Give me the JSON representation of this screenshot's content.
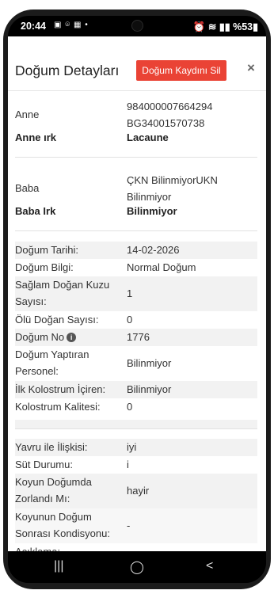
{
  "status_bar": {
    "time": "20:44",
    "left_icons": "▣ ⌾ ▦ •",
    "right_icons": "⏰ ≋ ▮▮ %53▮"
  },
  "modal": {
    "title": "Doğum Detayları",
    "delete_button": "Doğum Kaydını Sil",
    "close_label": "×"
  },
  "details": {
    "anne_label": "Anne",
    "anne_value_line1": "984000007664294",
    "anne_value_line2": "BG34001570738",
    "anne_irk_label": "Anne ırk",
    "anne_irk_value": "Lacaune",
    "baba_label": "Baba",
    "baba_value_line1": "ÇKN BilinmiyorUKN",
    "baba_value_line2": "Bilinmiyor",
    "baba_irk_label": "Baba Irk",
    "baba_irk_value": "Bilinmiyor",
    "dogum_tarihi_label": "Doğum Tarihi:",
    "dogum_tarihi_value": "14-02-2026",
    "dogum_bilgi_label": "Doğum Bilgi:",
    "dogum_bilgi_value": "Normal Doğum",
    "saglam_label_line1": "Sağlam Doğan Kuzu",
    "saglam_label_line2": "Sayısı:",
    "saglam_value": "1",
    "olu_label": "Ölü Doğan Sayısı:",
    "olu_value": "0",
    "dogum_no_label": "Doğum No",
    "dogum_no_value": "1776",
    "personel_label_line1": "Doğum Yaptıran",
    "personel_label_line2": "Personel:",
    "personel_value": "Bilinmiyor",
    "kolostrum_iceren_label": "İlk Kolostrum İçiren:",
    "kolostrum_iceren_value": "Bilinmiyor",
    "kolostrum_kalite_label": "Kolostrum Kalitesi:",
    "kolostrum_kalite_value": "0",
    "yavru_label": "Yavru ile İlişkisi:",
    "yavru_value": "iyi",
    "sut_label": "Süt Durumu:",
    "sut_value": "i",
    "zorlandi_label_line1": "Koyun Doğumda",
    "zorlandi_label_line2": "Zorlandı Mı:",
    "zorlandi_value": "hayir",
    "kondisyon_label_line1": "Koyunun Doğum",
    "kondisyon_label_line2": "Sonrası Kondisyonu:",
    "kondisyon_value": "-",
    "aciklama_label": "Açıklama:"
  },
  "nav_bar": {
    "recents": "|||",
    "home": "◯",
    "back": "<"
  }
}
